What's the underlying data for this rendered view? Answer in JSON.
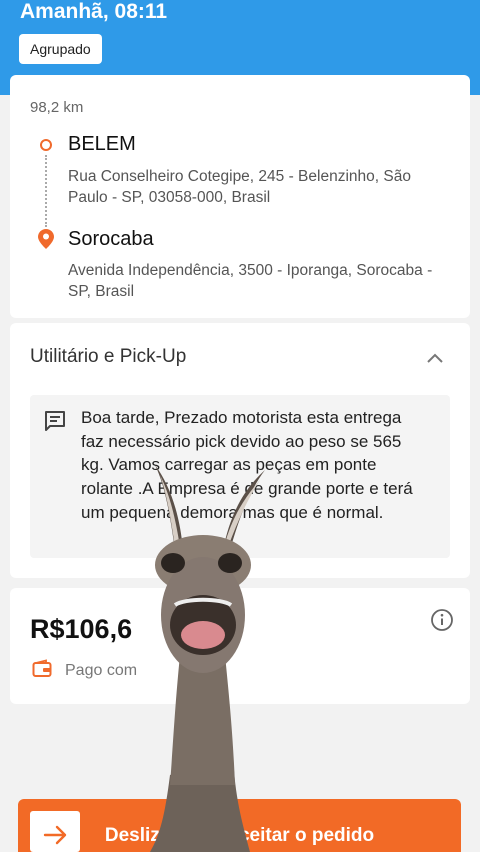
{
  "header": {
    "title": "Amanhã, 08:11",
    "badge": "Agrupado"
  },
  "route": {
    "distance": "98,2 km",
    "origin": {
      "name": "BELEM",
      "address": "Rua Conselheiro Cotegipe, 245 - Belenzinho, São Paulo - SP, 03058-000, Brasil"
    },
    "destination": {
      "name": "Sorocaba",
      "address": "Avenida Independência, 3500 - Iporanga, Sorocaba - SP, Brasil"
    }
  },
  "vehicle": {
    "title": "Utilitário e Pick-Up",
    "note": "Boa tarde, Prezado motorista esta entrega faz necessário pick devido ao peso se 565 kg.  Vamos carregar as peças em ponte rolante .A Empresa é de grande porte e terá um pequena demora mas que é normal."
  },
  "payment": {
    "price": "R$106,6",
    "paid_label": "Pago com"
  },
  "cta": {
    "label": "Deslizar para aceitar o pedido"
  },
  "colors": {
    "header": "#2f9ae8",
    "accent": "#f26a26"
  },
  "icons": [
    "origin-dot-icon",
    "map-pin-icon",
    "chevron-up-icon",
    "note-icon",
    "info-icon",
    "wallet-icon",
    "arrow-right-icon"
  ]
}
